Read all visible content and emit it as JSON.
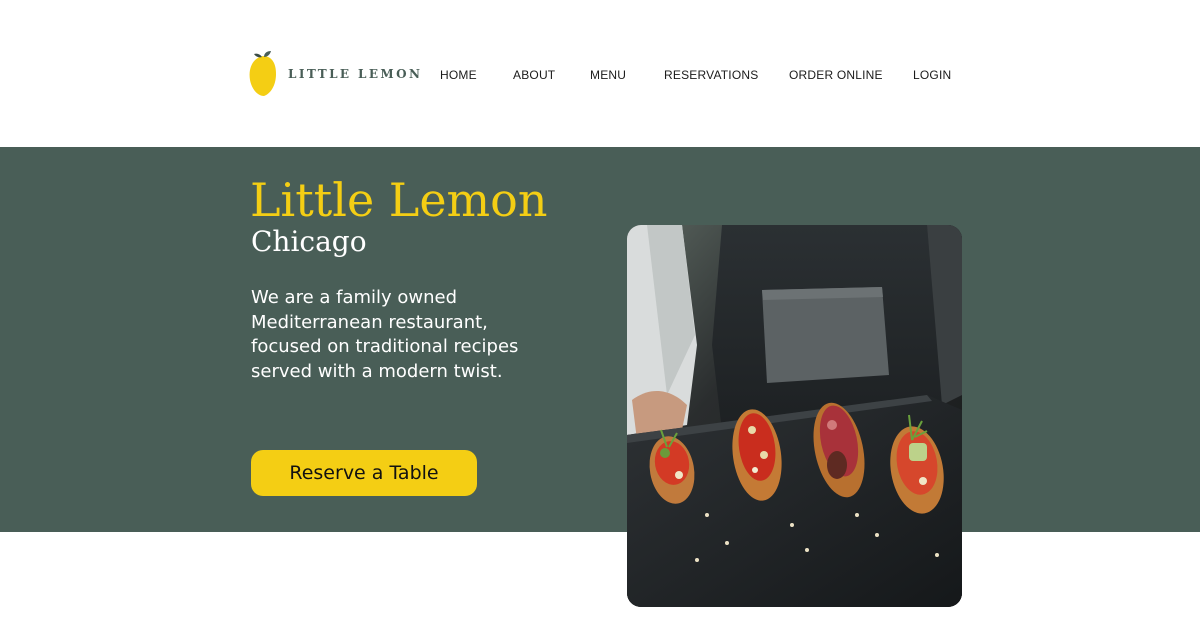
{
  "header": {
    "logo_text": "LITTLE LEMON",
    "logo_icon": "lemon-icon",
    "nav": [
      {
        "label": "HOME"
      },
      {
        "label": "ABOUT"
      },
      {
        "label": "MENU"
      },
      {
        "label": "RESERVATIONS"
      },
      {
        "label": "ORDER ONLINE"
      },
      {
        "label": "LOGIN"
      }
    ]
  },
  "hero": {
    "title": "Little Lemon",
    "subtitle": "Chicago",
    "description": "We are a family owned Mediterranean restaurant, focused on traditional recipes served with a modern twist.",
    "cta_label": "Reserve a Table",
    "image_subject": "chef holding slate tray of bruschetta appetizers"
  },
  "colors": {
    "primary_green": "#495e57",
    "primary_yellow": "#f4ce14",
    "background": "#ffffff",
    "text_dark": "#1b1b1b"
  }
}
